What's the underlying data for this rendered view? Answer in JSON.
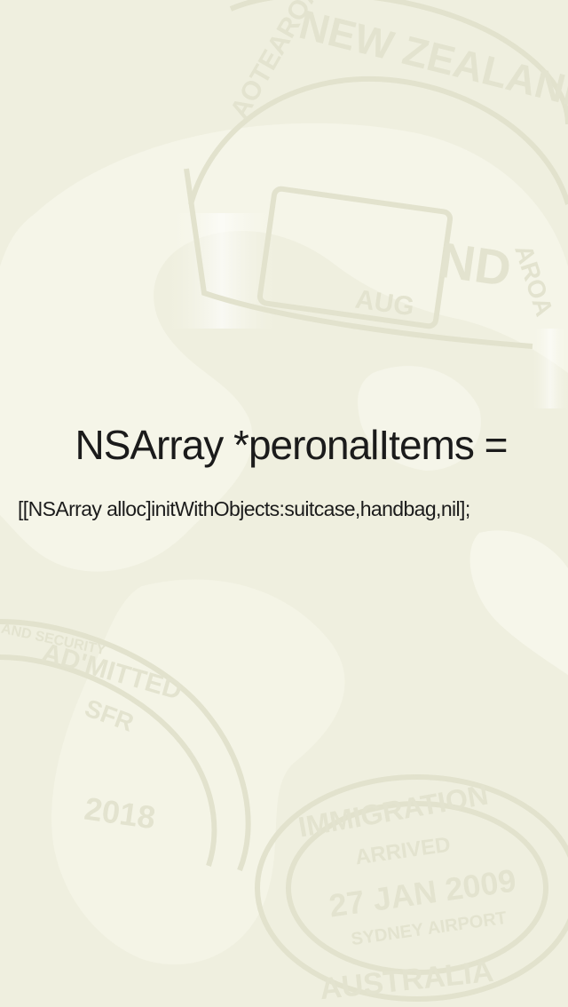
{
  "heading": {
    "text": "NSArray *peronalItems ="
  },
  "code": {
    "text": "[[NSArray alloc]initWithObjects:suitcase,handbag,nil];"
  },
  "background": {
    "color": "#efefdf",
    "decoration": "passport-stamps-world-map",
    "stamps": {
      "top_arc": "AOTEAROA",
      "top_title": "NEW ZEALAND",
      "top_partial_1": "AUG",
      "top_partial_2": "ND",
      "top_side": "AROA",
      "left_arc": "AND SECURITY",
      "left_admitted": "AD'MITTED",
      "left_code": "SFR",
      "left_year": "2018",
      "bottom_title": "IMMIGRATION",
      "bottom_status": "ARRIVED",
      "bottom_date": "27 JAN 2009",
      "bottom_place": "SYDNEY AIRPORT",
      "bottom_country": "AUSTRALIA"
    }
  }
}
